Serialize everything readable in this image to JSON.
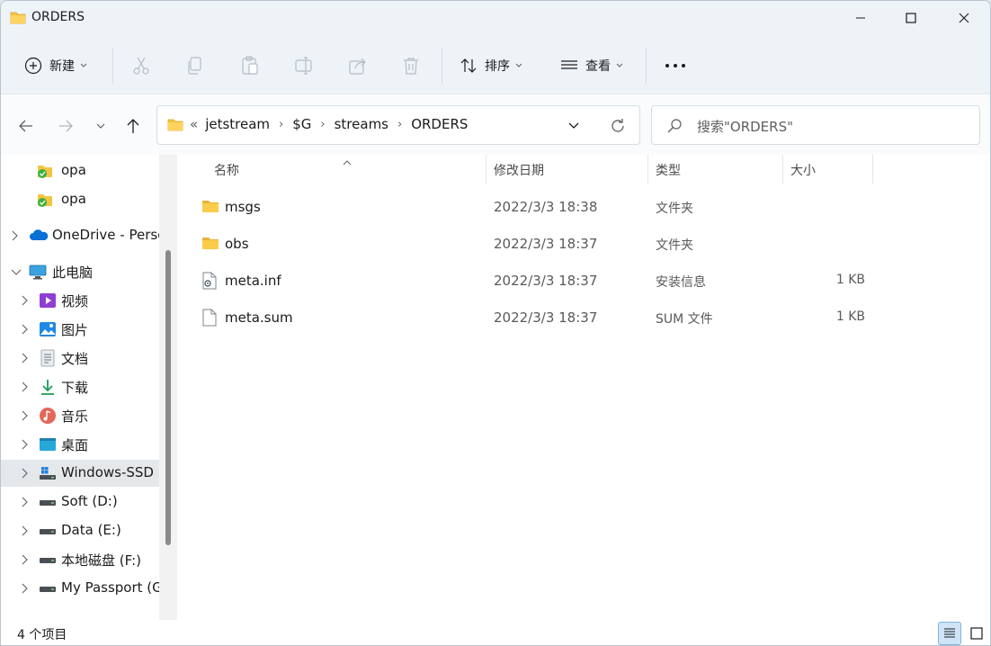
{
  "window": {
    "title": "ORDERS"
  },
  "toolbar": {
    "new_label": "新建",
    "sort_label": "排序",
    "view_label": "查看"
  },
  "address": {
    "lead": "«",
    "crumbs": [
      "jetstream",
      "$G",
      "streams",
      "ORDERS"
    ]
  },
  "search": {
    "placeholder": "搜索\"ORDERS\""
  },
  "sidebar": {
    "items": [
      {
        "label": "opa",
        "icon": "folder-sync-icon"
      },
      {
        "label": "opa",
        "icon": "folder-sync-icon"
      },
      {
        "label": "OneDrive - Perso",
        "icon": "onedrive-icon"
      },
      {
        "label": "此电脑",
        "icon": "pc-icon"
      },
      {
        "label": "视频",
        "icon": "video-icon"
      },
      {
        "label": "图片",
        "icon": "pictures-icon"
      },
      {
        "label": "文档",
        "icon": "documents-icon"
      },
      {
        "label": "下载",
        "icon": "download-icon"
      },
      {
        "label": "音乐",
        "icon": "music-icon"
      },
      {
        "label": "桌面",
        "icon": "desktop-icon"
      },
      {
        "label": "Windows-SSD (",
        "icon": "windows-drive-icon"
      },
      {
        "label": "Soft (D:)",
        "icon": "drive-icon"
      },
      {
        "label": "Data (E:)",
        "icon": "drive-icon"
      },
      {
        "label": "本地磁盘 (F:)",
        "icon": "drive-icon"
      },
      {
        "label": "My Passport (G",
        "icon": "drive-icon"
      }
    ]
  },
  "columns": {
    "name": "名称",
    "date": "修改日期",
    "type": "类型",
    "size": "大小"
  },
  "files": [
    {
      "name": "msgs",
      "date": "2022/3/3 18:38",
      "type": "文件夹",
      "size": "",
      "icon": "folder-icon"
    },
    {
      "name": "obs",
      "date": "2022/3/3 18:37",
      "type": "文件夹",
      "size": "",
      "icon": "folder-icon"
    },
    {
      "name": "meta.inf",
      "date": "2022/3/3 18:37",
      "type": "安装信息",
      "size": "1 KB",
      "icon": "settings-file-icon"
    },
    {
      "name": "meta.sum",
      "date": "2022/3/3 18:37",
      "type": "SUM 文件",
      "size": "1 KB",
      "icon": "blank-file-icon"
    }
  ],
  "status": {
    "item_count": "4 个项目"
  },
  "colors": {
    "accent": "#0067c0",
    "folder": "#f4c542",
    "chrome": "#eef3f8",
    "selected": "#e5e8eb"
  }
}
